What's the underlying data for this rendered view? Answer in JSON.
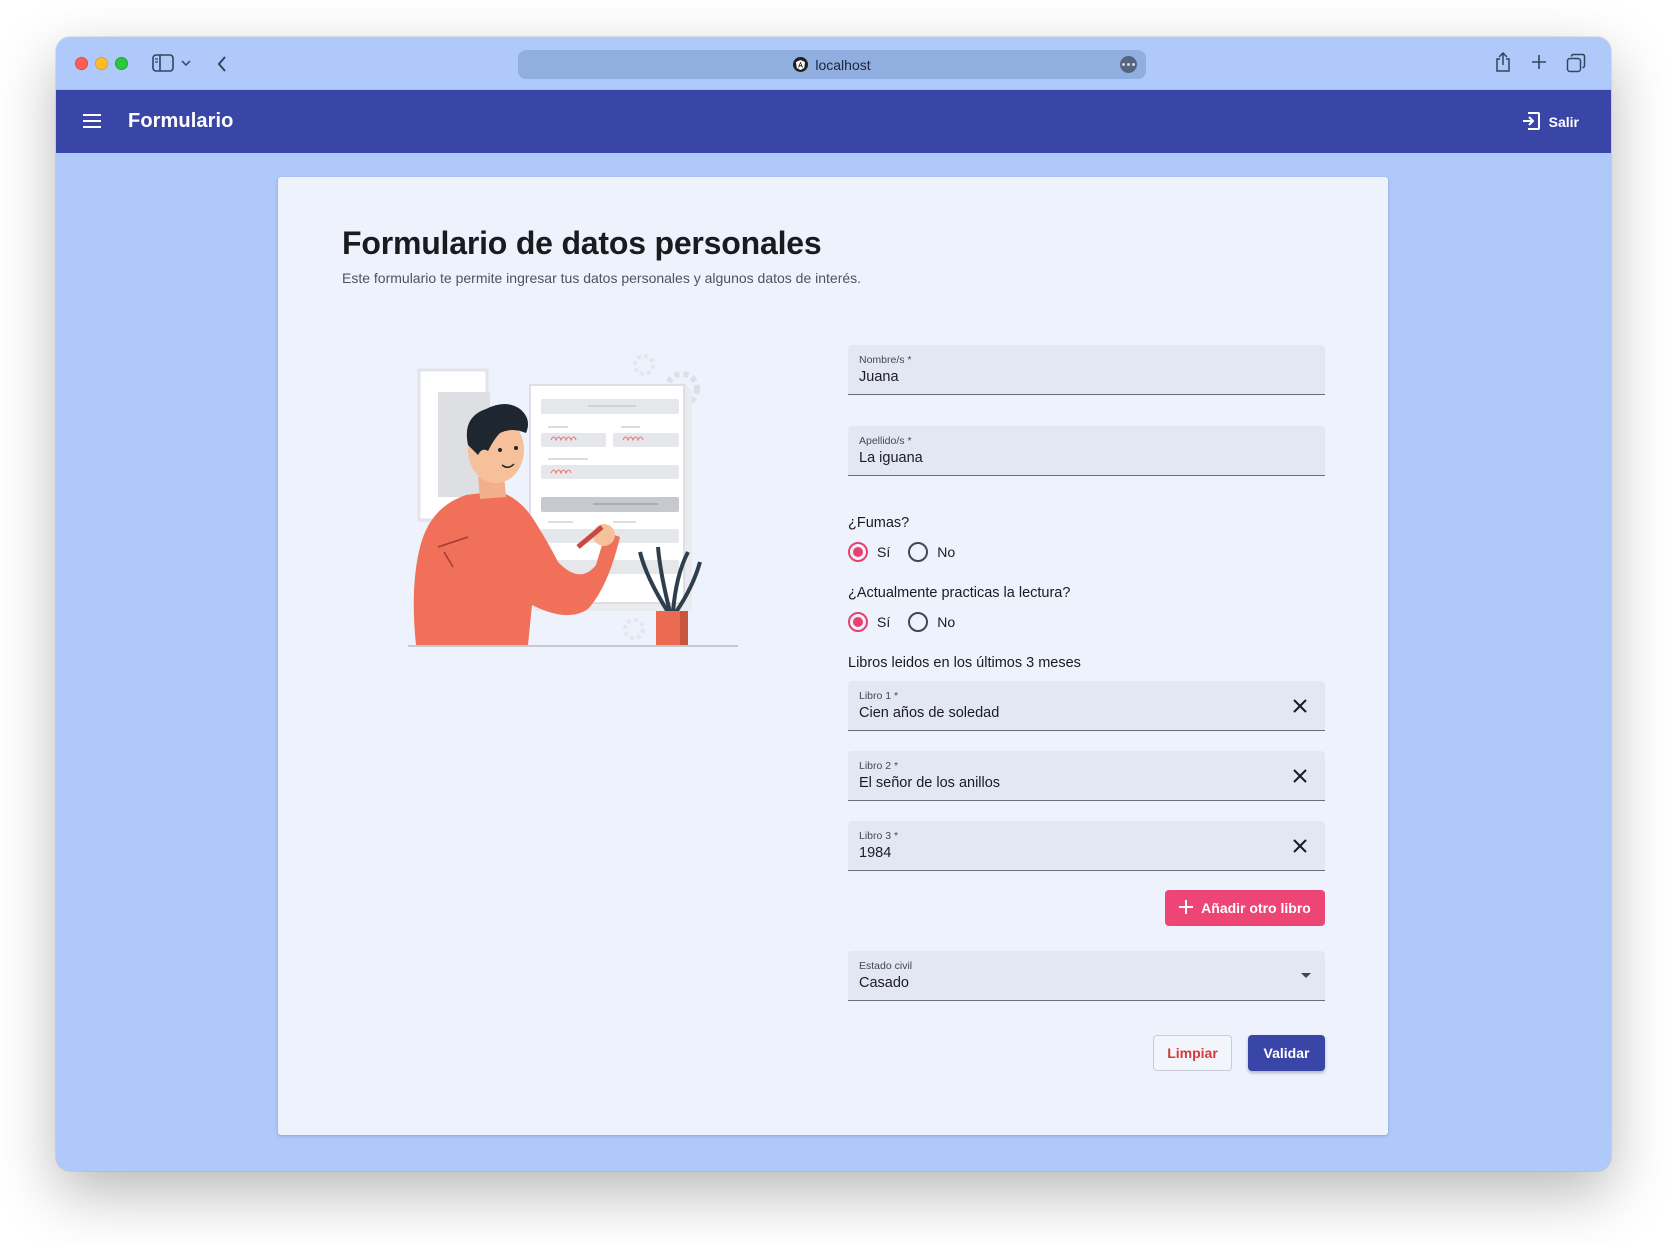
{
  "browser": {
    "url": "localhost"
  },
  "appbar": {
    "title": "Formulario",
    "logout_label": "Salir"
  },
  "form": {
    "title": "Formulario de datos personales",
    "subtitle": "Este formulario te permite ingresar tus datos personales y algunos datos de interés.",
    "nombre": {
      "label": "Nombre/s *",
      "value": "Juana"
    },
    "apellido": {
      "label": "Apellido/s *",
      "value": "La iguana"
    },
    "fumas": {
      "question": "¿Fumas?",
      "options": [
        "Sí",
        "No"
      ],
      "selected": "Sí"
    },
    "lectura": {
      "question": "¿Actualmente practicas la lectura?",
      "options": [
        "Sí",
        "No"
      ],
      "selected": "Sí"
    },
    "libros_heading": "Libros leidos en los últimos 3 meses",
    "libros": [
      {
        "label": "Libro 1 *",
        "value": "Cien años de soledad"
      },
      {
        "label": "Libro 2 *",
        "value": "El señor de los anillos"
      },
      {
        "label": "Libro 3 *",
        "value": "1984"
      }
    ],
    "add_book_label": "Añadir otro libro",
    "estado_civil": {
      "label": "Estado civil",
      "value": "Casado"
    },
    "clear_label": "Limpiar",
    "validate_label": "Validar"
  },
  "colors": {
    "primary": "#3a45a8",
    "accent": "#ed4676",
    "background": "#afc9fa",
    "card": "#edf2fd",
    "warn": "#d33a3a"
  },
  "icons": {
    "menu": "menu-icon",
    "logout": "logout-icon",
    "clear": "close-icon",
    "add": "plus-icon",
    "select": "dropdown-arrow-icon"
  }
}
